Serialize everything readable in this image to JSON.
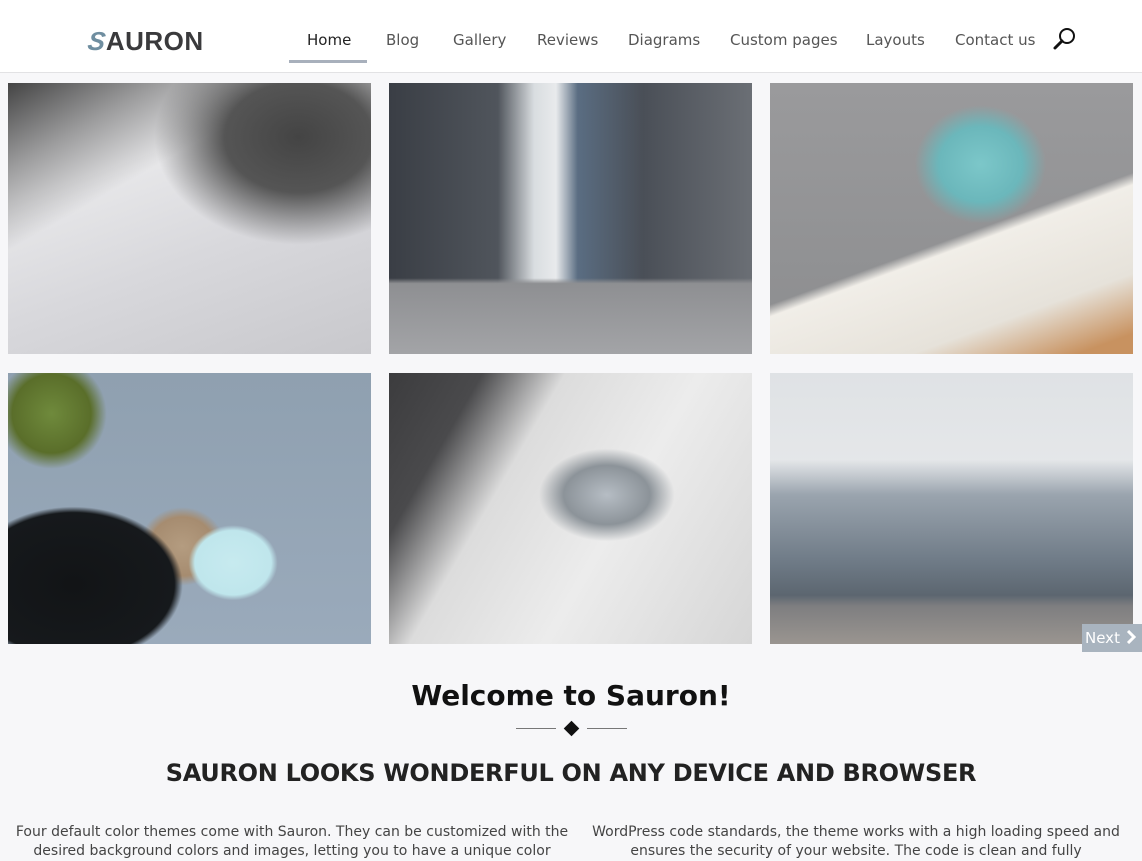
{
  "header": {
    "logo_first": "S",
    "logo_rest": "AURON",
    "nav": [
      {
        "label": "Home",
        "active": true
      },
      {
        "label": "Blog"
      },
      {
        "label": "Gallery"
      },
      {
        "label": "Reviews"
      },
      {
        "label": "Diagrams"
      },
      {
        "label": "Custom pages"
      },
      {
        "label": "Layouts"
      },
      {
        "label": "Contact us"
      }
    ],
    "search_icon": "search-icon"
  },
  "gallery": {
    "images": [
      {
        "alt": "Team working on paper layouts at a table"
      },
      {
        "alt": "City street between skyscrapers"
      },
      {
        "alt": "Coffee mug and open book"
      },
      {
        "alt": "Desk with tablet, notebook, glasses and envelope"
      },
      {
        "alt": "Man using tablet with coffee"
      },
      {
        "alt": "City skyline from waterfront promenade"
      }
    ],
    "next_label": "Next",
    "next_icon": "chevron-right-icon"
  },
  "welcome": {
    "title": "Welcome to Sauron!",
    "tagline": "SAURON LOOKS WONDERFUL ON ANY DEVICE AND BROWSER",
    "columns": [
      "Four default color themes come with Sauron. They can be customized with the desired background colors and images, letting you to have a unique color",
      "WordPress code standards, the theme works with a high loading speed and ensures the security of your website. The code is clean and fully"
    ]
  },
  "colors": {
    "nav_underline": "#a8b0bc",
    "next_button": "#a9b4bf",
    "page_bg": "#f7f7f9"
  }
}
